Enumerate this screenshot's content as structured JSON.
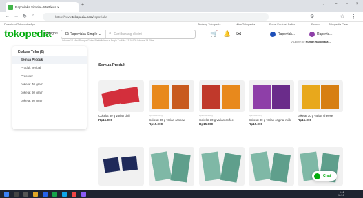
{
  "browser": {
    "tab_title": "Rapoviaka Simple - Martikula ×",
    "new_tab": "+",
    "url_prefix": "https://www.",
    "url_domain": "tokopedia.com",
    "url_path": "/rapoviaka",
    "bookmark": "Download Tokopedia App",
    "top_links": [
      "Tentang Tokopedia",
      "Mitra Tokopedia",
      "Pusat Edukasi Seller",
      "Promo",
      "Tokopedia Care"
    ]
  },
  "header": {
    "logo": "tokopedia",
    "kategori": "Kategori",
    "search_scope": "Di Rapoviaka Simple",
    "search_placeholder": "Cari barang di sini",
    "suggestions": "Iphone 12 Mini   Pompa Galon Elektrik   Kasur Angin   Tv Mito   13 10105   Iphone 14 Plus",
    "account_1": "Rapoviak...",
    "account_2": "Rapovia...",
    "deliver_label": "Dikirim ke",
    "deliver_to": "Rumah Rapoviaka"
  },
  "sidebar": {
    "title": "Etalase Toko (6)",
    "items": [
      "Semua Produk",
      "Produk Terjual",
      "Preorder",
      "cokelat 40 gram",
      "cokelat 60 gram",
      "cokelat 30 gram"
    ]
  },
  "main": {
    "title": "Semua Produk",
    "products": [
      {
        "shop": "",
        "name": "Cokelat 30 g varian chili",
        "price": "Rp15.000"
      },
      {
        "shop": "Rp15.000/100 g",
        "name": "Cokelat 30 g varian cashew",
        "price": "Rp15.000"
      },
      {
        "shop": "Rp15.000/100 g",
        "name": "Cokelat 30 g varian coffee",
        "price": "Rp15.000"
      },
      {
        "shop": "Rp15.000/100 g",
        "name": "Cokelat 30 g varian original milk",
        "price": "Rp15.000"
      },
      {
        "shop": "",
        "name": "cokelat 30 g varian cheese",
        "price": "Rp15.000"
      }
    ]
  },
  "chat": "Chat",
  "clock": {
    "time": "9:12",
    "date": "11/10"
  },
  "colors": {
    "brand": "#03ac0e",
    "pouch_red": "#d32f3c",
    "pouch_purple": "#8e3fa8",
    "pouch_orange": "#e8891c"
  }
}
